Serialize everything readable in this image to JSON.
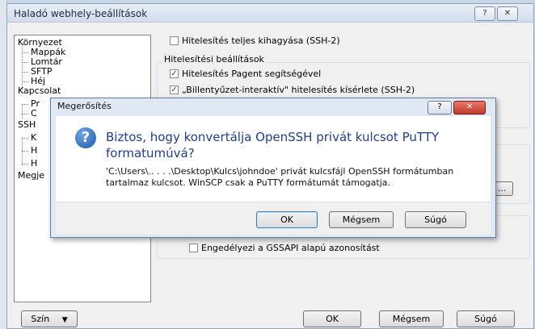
{
  "outer": {
    "title": "Haladó webhely-beállítások",
    "help_glyph": "?",
    "close_glyph": "✕",
    "tree": [
      {
        "label": "Környezet",
        "level": 0
      },
      {
        "label": "Mappák",
        "level": 1
      },
      {
        "label": "Lomtár",
        "level": 1
      },
      {
        "label": "SFTP",
        "level": 1
      },
      {
        "label": "Héj",
        "level": 1
      },
      {
        "label": "Kapcsolat",
        "level": 0
      },
      {
        "label": "Pr",
        "level": 1
      },
      {
        "label": "C",
        "level": 1
      },
      {
        "label": "SSH",
        "level": 0
      },
      {
        "label": "K",
        "level": 1
      },
      {
        "label": "H",
        "level": 1
      },
      {
        "label": "H",
        "level": 1
      },
      {
        "label": "Megje",
        "level": 0
      }
    ],
    "opt_skip_auth": "Hitelesítés teljes kihagyása (SSH-2)",
    "group_auth": "Hitelesítési beállítások",
    "opt_pageant": "Hitelesítés Pagent segítségével",
    "opt_keyboard": "„Billentyűzet-interaktív\" hitelesítés kísérlete (SSH-2)",
    "opt_gssapi": "Engedélyezi a GSSAPI alapú azonosítást",
    "browse_label": "...",
    "color_btn": "Szín",
    "ok_btn": "OK",
    "cancel_btn": "Mégsem",
    "help_btn": "Súgó"
  },
  "dialog": {
    "title": "Megerősítés",
    "help_glyph": "?",
    "close_glyph": "✕",
    "icon": "question-icon",
    "main": "Biztos, hogy konvertálja OpenSSH privát kulcsot PuTTY formatumúvá?",
    "content": "'C:\\Users\\..  .  . .\\Desktop\\Kulcs\\johndoe' privát kulcsfájl OpenSSH formátumban tartalmaz kulcsot. WinSCP csak a PuTTY formátumát támogatja.",
    "ok": "OK",
    "cancel": "Mégsem",
    "help": "Súgó"
  }
}
